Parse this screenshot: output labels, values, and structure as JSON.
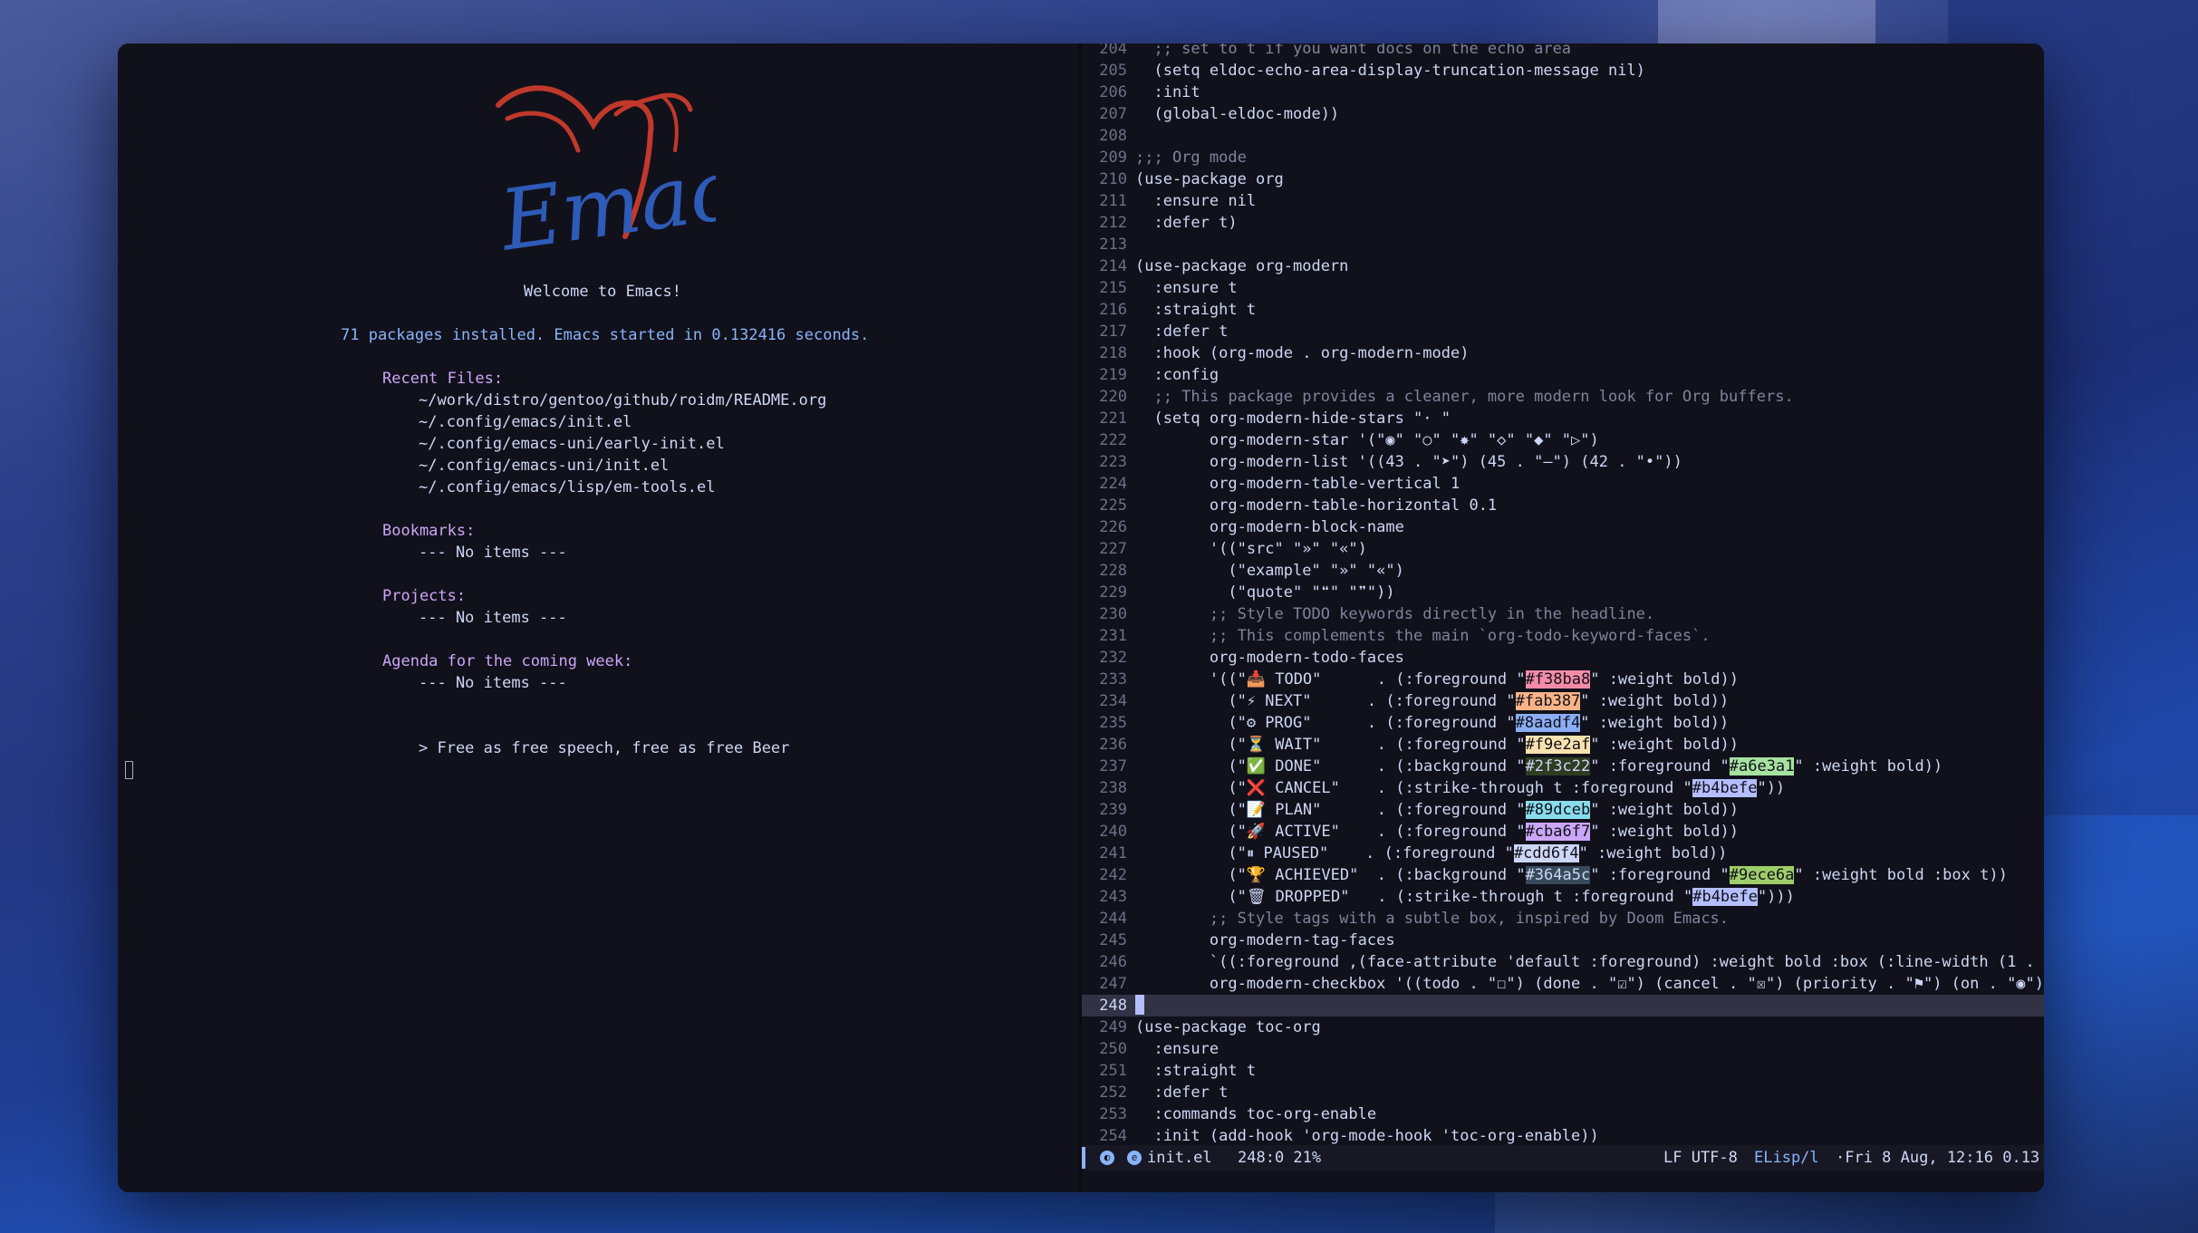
{
  "dashboard": {
    "welcome": "Welcome to Emacs!",
    "info": "71 packages installed. Emacs started in 0.132416 seconds.",
    "recent_files_heading": "Recent Files:",
    "recent_files": [
      "~/work/distro/gentoo/github/roidm/README.org",
      "~/.config/emacs/init.el",
      "~/.config/emacs-uni/early-init.el",
      "~/.config/emacs-uni/init.el",
      "~/.config/emacs/lisp/em-tools.el"
    ],
    "bookmarks_heading": "Bookmarks:",
    "bookmarks_empty": "--- No items ---",
    "projects_heading": "Projects:",
    "projects_empty": "--- No items ---",
    "agenda_heading": "Agenda for the coming week:",
    "agenda_empty": "--- No items ---",
    "footer": "> Free as free speech, free as free Beer"
  },
  "code_lines": [
    {
      "n": "204",
      "t": "  ;; set to t if you want docs on the echo area"
    },
    {
      "n": "205",
      "t": "  (setq eldoc-echo-area-display-truncation-message nil)"
    },
    {
      "n": "206",
      "t": "  :init"
    },
    {
      "n": "207",
      "t": "  (global-eldoc-mode))"
    },
    {
      "n": "208",
      "t": ""
    },
    {
      "n": "209",
      "t": ";;; Org mode"
    },
    {
      "n": "210",
      "t": "(use-package org"
    },
    {
      "n": "211",
      "t": "  :ensure nil"
    },
    {
      "n": "212",
      "t": "  :defer t)"
    },
    {
      "n": "213",
      "t": ""
    },
    {
      "n": "214",
      "t": "(use-package org-modern"
    },
    {
      "n": "215",
      "t": "  :ensure t"
    },
    {
      "n": "216",
      "t": "  :straight t"
    },
    {
      "n": "217",
      "t": "  :defer t"
    },
    {
      "n": "218",
      "t": "  :hook (org-mode . org-modern-mode)"
    },
    {
      "n": "219",
      "t": "  :config"
    },
    {
      "n": "220",
      "t": "  ;; This package provides a cleaner, more modern look for Org buffers."
    },
    {
      "n": "221",
      "t": "  (setq org-modern-hide-stars \"· \""
    },
    {
      "n": "222",
      "t": "        org-modern-star '(\"◉\" \"○\" \"✸\" \"◇\" \"◆\" \"▷\")"
    },
    {
      "n": "223",
      "t": "        org-modern-list '((43 . \"➤\") (45 . \"–\") (42 . \"•\"))"
    },
    {
      "n": "224",
      "t": "        org-modern-table-vertical 1"
    },
    {
      "n": "225",
      "t": "        org-modern-table-horizontal 0.1"
    },
    {
      "n": "226",
      "t": "        org-modern-block-name"
    },
    {
      "n": "227",
      "t": "        '((\"src\" \"»\" \"«\")"
    },
    {
      "n": "228",
      "t": "          (\"example\" \"»\" \"«\")"
    },
    {
      "n": "229",
      "t": "          (\"quote\" \"❝\" \"❞\"))"
    },
    {
      "n": "230",
      "t": "        ;; Style TODO keywords directly in the headline."
    },
    {
      "n": "231",
      "t": "        ;; This complements the main `org-todo-keyword-faces`."
    },
    {
      "n": "232",
      "t": "        org-modern-todo-faces"
    },
    {
      "n": "233",
      "t": "        '((\"📥 TODO\"      . (:foreground \"#f38ba8\" :weight bold))"
    },
    {
      "n": "234",
      "t": "          (\"⚡ NEXT\"      . (:foreground \"#fab387\" :weight bold))"
    },
    {
      "n": "235",
      "t": "          (\"⚙ PROG\"      . (:foreground \"#8aadf4\" :weight bold))"
    },
    {
      "n": "236",
      "t": "          (\"⏳ WAIT\"      . (:foreground \"#f9e2af\" :weight bold))"
    },
    {
      "n": "237",
      "t": "          (\"✅ DONE\"      . (:background \"#2f3c22\" :foreground \"#a6e3a1\" :weight bold))"
    },
    {
      "n": "238",
      "t": "          (\"❌ CANCEL\"    . (:strike-through t :foreground \"#b4befe\"))"
    },
    {
      "n": "239",
      "t": "          (\"📝 PLAN\"      . (:foreground \"#89dceb\" :weight bold))"
    },
    {
      "n": "240",
      "t": "          (\"🚀 ACTIVE\"    . (:foreground \"#cba6f7\" :weight bold))"
    },
    {
      "n": "241",
      "t": "          (\"⏸ PAUSED\"    . (:foreground \"#cdd6f4\" :weight bold))"
    },
    {
      "n": "242",
      "t": "          (\"🏆 ACHIEVED\"  . (:background \"#364a5c\" :foreground \"#9ece6a\" :weight bold :box t))"
    },
    {
      "n": "243",
      "t": "          (\"🗑 DROPPED\"   . (:strike-through t :foreground \"#b4befe\")))"
    },
    {
      "n": "244",
      "t": "        ;; Style tags with a subtle box, inspired by Doom Emacs."
    },
    {
      "n": "245",
      "t": "        org-modern-tag-faces"
    },
    {
      "n": "246",
      "t": "        `((:foreground ,(face-attribute 'default :foreground) :weight bold :box (:line-width (1 . -1"
    },
    {
      "n": "247",
      "t": "        org-modern-checkbox '((todo . \"☐\") (done . \"☑\") (cancel . \"☒\") (priority . \"⚑\") (on . \"◉\") ("
    },
    {
      "n": "248",
      "t": ""
    },
    {
      "n": "249",
      "t": "(use-package toc-org"
    },
    {
      "n": "250",
      "t": "  :ensure"
    },
    {
      "n": "251",
      "t": "  :straight t"
    },
    {
      "n": "252",
      "t": "  :defer t"
    },
    {
      "n": "253",
      "t": "  :commands toc-org-enable"
    },
    {
      "n": "254",
      "t": "  :init (add-hook 'org-mode-hook 'toc-org-enable))"
    }
  ],
  "modeline": {
    "buffer": "init.el",
    "position": "248:0 21%",
    "encoding": "LF UTF-8",
    "mode": "ELisp/l",
    "datetime": "·Fri 8 Aug, 12:16 0.13"
  },
  "colors": {
    "bg": "#11111b",
    "line_number": "#6c7086",
    "keyword": "#cba6f7",
    "accent": "#89b4fa",
    "current_line": "#313244"
  }
}
